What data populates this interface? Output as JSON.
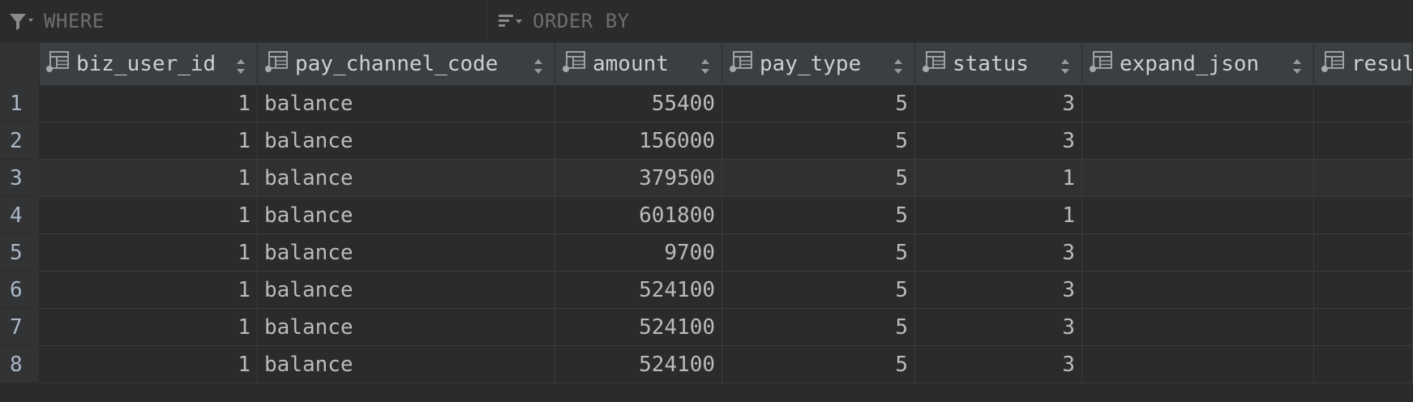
{
  "filters": {
    "where_label": "WHERE",
    "order_label": "ORDER BY"
  },
  "columns": [
    {
      "key": "biz_user_id",
      "label": "biz_user_id",
      "align": "num"
    },
    {
      "key": "pay_channel_code",
      "label": "pay_channel_code",
      "align": "text"
    },
    {
      "key": "amount",
      "label": "amount",
      "align": "num"
    },
    {
      "key": "pay_type",
      "label": "pay_type",
      "align": "num"
    },
    {
      "key": "status",
      "label": "status",
      "align": "num"
    },
    {
      "key": "expand_json",
      "label": "expand_json",
      "align": "text"
    },
    {
      "key": "resul",
      "label": "resul",
      "align": "text"
    }
  ],
  "rows": [
    {
      "num": "1",
      "cells": [
        "1",
        "balance",
        "55400",
        "5",
        "3",
        "",
        ""
      ]
    },
    {
      "num": "2",
      "cells": [
        "1",
        "balance",
        "156000",
        "5",
        "3",
        "",
        ""
      ]
    },
    {
      "num": "3",
      "cells": [
        "1",
        "balance",
        "379500",
        "5",
        "1",
        "",
        ""
      ]
    },
    {
      "num": "4",
      "cells": [
        "1",
        "balance",
        "601800",
        "5",
        "1",
        "",
        ""
      ]
    },
    {
      "num": "5",
      "cells": [
        "1",
        "balance",
        "9700",
        "5",
        "3",
        "",
        ""
      ]
    },
    {
      "num": "6",
      "cells": [
        "1",
        "balance",
        "524100",
        "5",
        "3",
        "",
        ""
      ]
    },
    {
      "num": "7",
      "cells": [
        "1",
        "balance",
        "524100",
        "5",
        "3",
        "",
        ""
      ]
    },
    {
      "num": "8",
      "cells": [
        "1",
        "balance",
        "524100",
        "5",
        "3",
        "",
        ""
      ]
    }
  ],
  "selected_row": 3
}
